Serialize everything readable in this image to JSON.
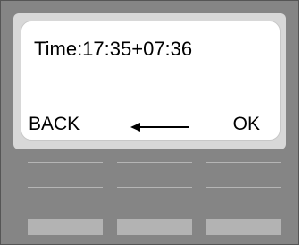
{
  "display": {
    "time_line": "Time:17:35+07:36",
    "left_softkey": "BACK",
    "right_softkey": "OK",
    "arrow_icon": "left-arrow-icon"
  },
  "colors": {
    "device_body": "#858585",
    "screen_bezel": "#d8d8d8",
    "screen": "#ffffff",
    "keys": "#b3b3b3"
  }
}
